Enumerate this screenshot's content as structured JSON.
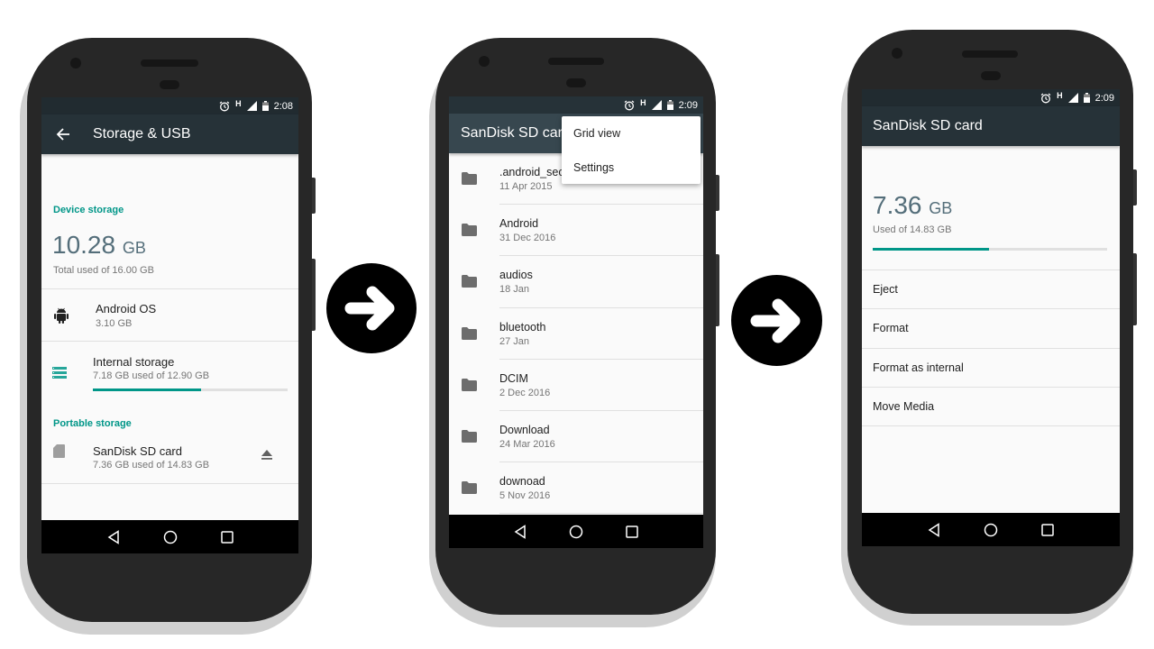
{
  "phones": [
    {
      "status": {
        "time": "2:08",
        "network": "H"
      },
      "appbar": {
        "title": "Storage & USB",
        "back_icon": "arrow-left-icon"
      },
      "device_storage": {
        "section_label": "Device storage",
        "used_value": "10.28",
        "used_unit": "GB",
        "total_text": "Total used of 16.00 GB"
      },
      "items": [
        {
          "title": "Android OS",
          "subtitle": "3.10 GB",
          "icon": "android-icon"
        },
        {
          "title": "Internal storage",
          "subtitle": "7.18 GB used of 12.90 GB",
          "icon": "storage-list-icon",
          "progress": 0.557
        }
      ],
      "portable_storage": {
        "section_label": "Portable storage",
        "title": "SanDisk SD card",
        "subtitle": "7.36 GB used of 14.83 GB",
        "icon": "sd-card-icon",
        "action_icon": "eject-icon"
      }
    },
    {
      "status": {
        "time": "2:09",
        "network": "H"
      },
      "appbar": {
        "title": "SanDisk SD card"
      },
      "overflow_menu": [
        "Grid view",
        "Settings"
      ],
      "folders": [
        {
          "name": ".android_secure",
          "date": "11 Apr 2015"
        },
        {
          "name": "Android",
          "date": "31 Dec 2016"
        },
        {
          "name": "audios",
          "date": "18 Jan"
        },
        {
          "name": "bluetooth",
          "date": "27 Jan"
        },
        {
          "name": "DCIM",
          "date": "2 Dec 2016"
        },
        {
          "name": "Download",
          "date": "24 Mar 2016"
        },
        {
          "name": "downoad",
          "date": "5 Nov 2016"
        }
      ]
    },
    {
      "status": {
        "time": "2:09",
        "network": "H"
      },
      "appbar": {
        "title": "SanDisk SD card"
      },
      "usage": {
        "used_value": "7.36",
        "used_unit": "GB",
        "total_text": "Used of 14.83 GB",
        "progress": 0.496
      },
      "actions": [
        "Eject",
        "Format",
        "Format as internal",
        "Move Media"
      ]
    }
  ],
  "transitions": [
    {
      "icon": "arrow-right-icon"
    },
    {
      "icon": "arrow-right-icon"
    }
  ],
  "colors": {
    "accent": "#009688",
    "appbar": "#263238",
    "statusbar": "#212b30",
    "number": "#546e7a"
  }
}
